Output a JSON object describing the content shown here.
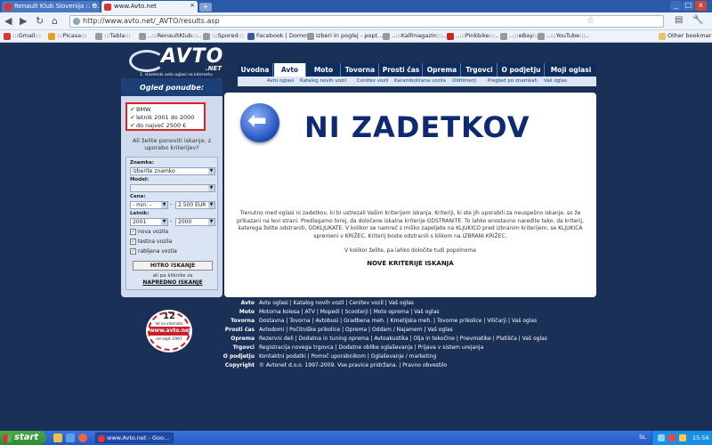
{
  "browser": {
    "tabs": [
      "Renault Klub Slovenija :: O...",
      "www.Avto.net"
    ],
    "new_tab": "+",
    "url": "http://www.avto.net/_AVTO/results.asp",
    "bookmarks": [
      ":::Gmail:::",
      ":::Picasa:::",
      ":::Tabla:::",
      "..:::RenaultKlub:::..",
      ":::Spored:::",
      "Facebook | Domov",
      "Izberi in poglej - popt...",
      "..:::Kalfmagazin:::..",
      "..:::Pinkbike:::..",
      "..:::eBay:::..",
      "..:::YouTube:::..",
      "Other bookmarks"
    ],
    "window": {
      "min": "_",
      "max": "□",
      "close": "x"
    }
  },
  "site": {
    "logo": {
      "brand": "AVTO",
      "tld": ".NET",
      "tagline": "1. slovenski avto oglasi na internetu"
    },
    "nav": [
      "Uvodna",
      "Avto",
      "Moto",
      "Tovorna",
      "Prosti čas",
      "Oprema",
      "Trgovci",
      "O podjetju",
      "Moji oglasi"
    ],
    "subnav": [
      "Avto oglasi",
      "Katalog novih vozil",
      "Cenitev vozil",
      "Karambolirana vozila",
      "Oldtimerji",
      "Pregled po znamkah",
      "Vaš oglas"
    ]
  },
  "sidebar": {
    "title": "Ogled ponudbe:",
    "criteria": [
      "BMW",
      "letnik 2001 do 2000",
      "do največ 2500 €"
    ],
    "repeat_text": "Ali želite ponoviti iskanje, z uporabo kriterijev?",
    "brand_label": "Znamka:",
    "brand_value": "izberite znamko",
    "model_label": "Model:",
    "model_value": "",
    "price_label": "Cena:",
    "price_from": "- min. -",
    "price_to": "2.500 EUR",
    "year_label": "Letnik:",
    "year_from": "2001",
    "year_to": "2000",
    "checkboxes": [
      "nova vozila",
      "testna vozila",
      "rabljena vozila"
    ],
    "search_button": "HITRO ISKANJE",
    "or_note": "ali pa kliknite za",
    "advanced": "NAPREDNO ISKANJE"
  },
  "content": {
    "heading": "NI ZADETKOV",
    "message": "Trenutno med oglasi ni zadetkov, ki bi ustrezali Vašim kriterijem iskanja. Kriteriji, ki ste jih uporabili za neuspešno iskanje, so že prikazani na levi strani. Predlagamo torej, da določene iskalne kriterije ODSTRANITE. To lahko enostavno naredite tako, da kriterij, katerega želite odstraniti, ODKLJUKATE. V kolikor se namreč z miško zapeljete na KLJUKICO pred izbranim kriterijem, se KLJUKICA spremeni v KRIŽEC. Kriterij boste odstranili s klikom na IZBRANI KRIŽEC.",
    "message2": "V kolikor želite, pa lahko določite tudi popolnoma",
    "new_criteria": "NOVE KRITERIJE ISKANJA"
  },
  "badge": {
    "number": "12",
    "line1": "let na internetu",
    "site": "www.avto.net",
    "since": "od sept.1997"
  },
  "footer": [
    {
      "label": "Avto",
      "links": "Avto oglasi | Katalog novih vozil | Cenitev vozil | Vaš oglas"
    },
    {
      "label": "Moto",
      "links": "Motorna kolesa | ATV | Mopedi | Scooterji | Moto oprema | Vaš oglas"
    },
    {
      "label": "Tovorna",
      "links": "Dostavna | Tovorna | Avtobusi | Gradbena meh. | Kmetijska meh. | Tovorne prikolice | Viličarji | Vaš oglas"
    },
    {
      "label": "Prosti čas",
      "links": "Avtodomi | Počitniške prikolice | Oprema | Oddam / Najamem | Vaš oglas"
    },
    {
      "label": "Oprema",
      "links": "Rezervni deli | Dodatna in tuning oprema | Avtoakustika | Olja in tekočine | Pnevmatike | Platišča | Vaš oglas"
    },
    {
      "label": "Trgovci",
      "links": "Registracija novega trgovca | Dodatne oblike oglaševanja | Prijava v sistem urejanja"
    },
    {
      "label": "O podjetju",
      "links": "Kontaktni podatki | Pomoč uporabnikom | Oglaševanje / marketing"
    },
    {
      "label": "Copyright",
      "links": "© Avtonet d.o.o. 1997-2009. Vse pravice pridržana. | Pravno obvestilo"
    }
  ],
  "taskbar": {
    "start": "start",
    "item": "www.Avto.net - Goo...",
    "lang": "SL",
    "clock": "15:56"
  },
  "colors": {
    "navy": "#0e2d5f",
    "accent": "#e0222a",
    "background": "#1b3056"
  }
}
